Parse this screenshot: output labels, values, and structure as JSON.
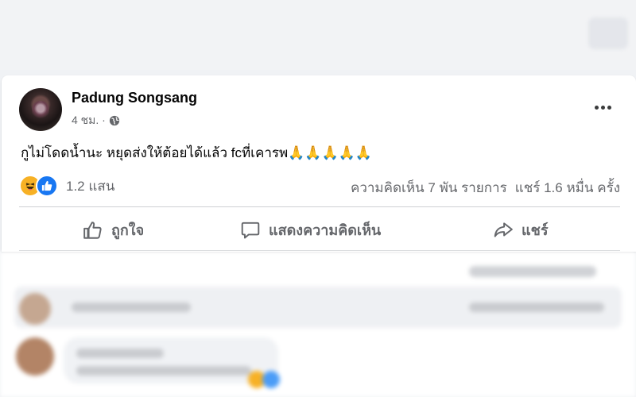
{
  "post": {
    "author": "Padung Songsang",
    "time": "4 ชม. ·",
    "text": "กูไม่โดดน้ำนะ หยุดส่งให้ต้อยได้แล้ว fcที่เคารพ🙏🙏🙏🙏🙏",
    "reactions_count": "1.2 แสน",
    "comments_stat": "ความคิดเห็น 7 พัน รายการ",
    "shares_stat": "แชร์ 1.6 หมื่น ครั้ง"
  },
  "actions": {
    "like": "ถูกใจ",
    "comment": "แสดงความคิดเห็น",
    "share": "แชร์"
  },
  "icons": {
    "privacy": "globe-icon",
    "menu": "more-horizontal-icon",
    "reaction_1": "haha-reaction-icon",
    "reaction_2": "like-reaction-icon",
    "like": "thumbs-up-icon",
    "comment": "comment-bubble-icon",
    "share": "share-arrow-icon"
  },
  "colors": {
    "like_blue": "#1877f2",
    "haha_yellow": "#f7b125",
    "secondary_text": "#65676b"
  }
}
